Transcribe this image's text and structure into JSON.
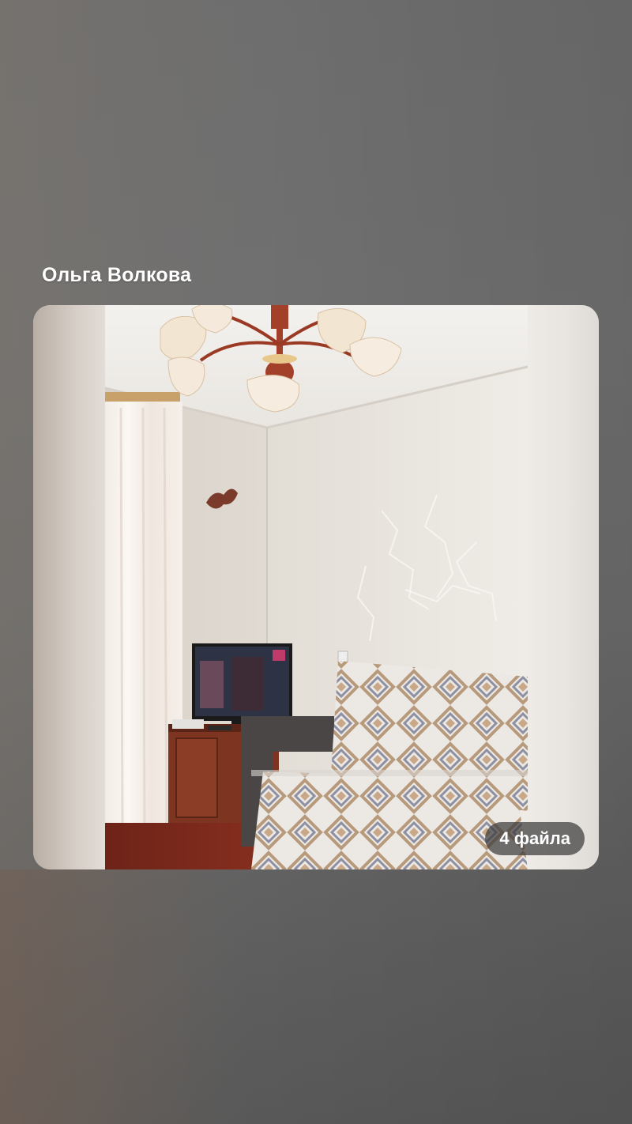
{
  "post": {
    "author_name": "Ольга Волкова",
    "file_count_label": "4 файла"
  },
  "colors": {
    "background": "#6e6e6e",
    "badge_background": "#3c3c3c",
    "text": "#ffffff"
  },
  "icons": {
    "photo": "room-photo"
  }
}
